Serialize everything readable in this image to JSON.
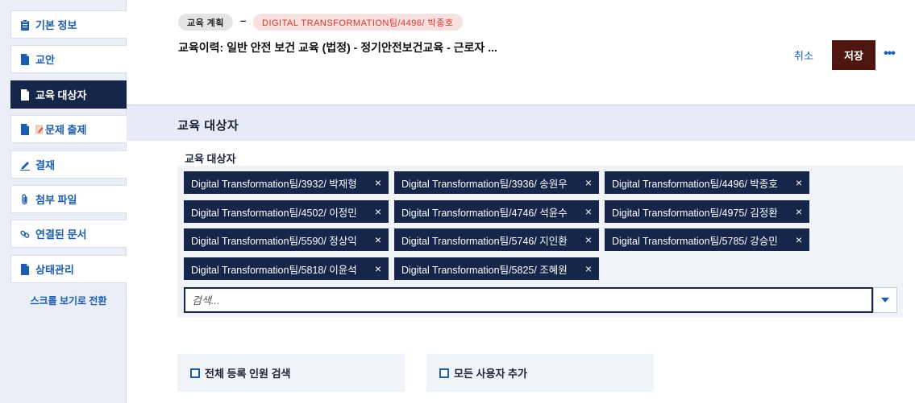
{
  "sidebar": {
    "items": [
      {
        "label": "기본 정보",
        "icon": "clipboard-icon"
      },
      {
        "label": "교안",
        "icon": "document-icon"
      },
      {
        "label": "교육 대상자",
        "icon": "document-icon",
        "active": true
      },
      {
        "label": "문제 출제",
        "icon": "document-icon",
        "extra_icon": "pencil-note-icon"
      },
      {
        "label": "결재",
        "icon": "pen-icon"
      },
      {
        "label": "첨부 파일",
        "icon": "paperclip-icon"
      },
      {
        "label": "연결된 문서",
        "icon": "link-icon"
      },
      {
        "label": "상태관리",
        "icon": "document-icon"
      }
    ],
    "scroll_toggle": "스크롤 보기로 전환"
  },
  "header": {
    "chip_plan": "교육 계획",
    "chip_dash": "–",
    "chip_owner": "DIGITAL TRANSFORMATION팀/4496/ 박종호",
    "history_title": "교육이력: 일반 안전 보건 교육 (법정) - 정기안전보건교육 - 근로자 ...",
    "cancel_label": "취소",
    "save_label": "저장",
    "more_label": "•••"
  },
  "section": {
    "title": "교육 대상자",
    "field_label": "교육 대상자",
    "tags": [
      "Digital Transformation팀/3932/ 박재형",
      "Digital Transformation팀/3936/ 송원우",
      "Digital Transformation팀/4496/ 박종호",
      "Digital Transformation팀/4502/ 이정민",
      "Digital Transformation팀/4746/ 석윤수",
      "Digital Transformation팀/4975/ 김정환",
      "Digital Transformation팀/5590/ 정상익",
      "Digital Transformation팀/5746/ 지인환",
      "Digital Transformation팀/5785/ 강승민",
      "Digital Transformation팀/5818/ 이윤석",
      "Digital Transformation팀/5825/ 조혜원"
    ],
    "tag_remove": "×",
    "search_placeholder": "검색...",
    "option_all": "전체 등록 인원 검색",
    "option_add_all": "모든 사용자 추가"
  },
  "colors": {
    "navy": "#16254a",
    "save_bg": "#4f1610",
    "link_blue": "#1d5dae",
    "owner_chip_text": "#d8352a",
    "sidebar_bg": "#e9eef7"
  }
}
